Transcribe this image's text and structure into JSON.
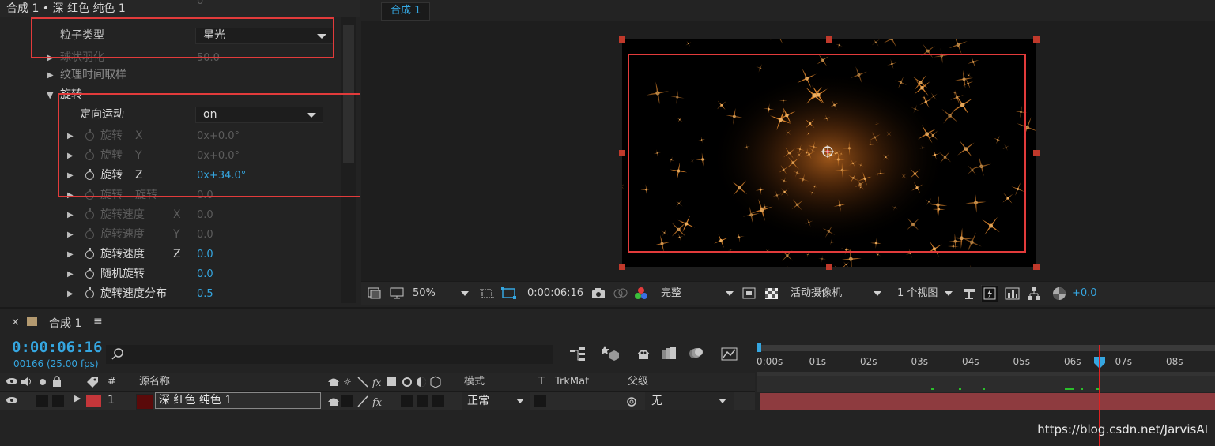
{
  "effects_panel": {
    "header": "合成 1 • 深 红色 纯色 1",
    "header_partial_value": "0",
    "rows": {
      "particle_type_label": "粒子类型",
      "particle_type_value": "星光",
      "sphere_feather_label": "球状羽化",
      "sphere_feather_value": "50.0",
      "texture_time_label": "纹理时间取样",
      "rotation_label": "旋转",
      "orient_motion_label": "定向运动",
      "orient_motion_value": "on",
      "rot_x_label": "旋转",
      "rot_x_axis": "X",
      "rot_x_value": "0x+0.0°",
      "rot_y_label": "旋转",
      "rot_y_axis": "Y",
      "rot_y_value": "0x+0.0°",
      "rot_z_label": "旋转",
      "rot_z_axis": "Z",
      "rot_z_value": "0x+34.0°",
      "rot_spin_label": "旋转",
      "rot_spin_label2": "旋转",
      "rot_spin_value": "0.0",
      "rspeed_x_label": "旋转速度",
      "rspeed_x_axis": "X",
      "rspeed_x_value": "0.0",
      "rspeed_y_label": "旋转速度",
      "rspeed_y_axis": "Y",
      "rspeed_y_value": "0.0",
      "rspeed_z_label": "旋转速度",
      "rspeed_z_axis": "Z",
      "rspeed_z_value": "0.0",
      "random_rot_label": "随机旋转",
      "random_rot_value": "0.0",
      "rspeed_dist_label": "旋转速度分布",
      "rspeed_dist_value": "0.5"
    }
  },
  "viewer": {
    "tab": "合成 1",
    "zoom": "50%",
    "timecode": "0:00:06:16",
    "resolution": "完整",
    "camera": "活动摄像机",
    "views": "1 个视图",
    "exposure": "+0.0"
  },
  "timeline": {
    "tab": "合成 1",
    "timecode": "0:00:06:16",
    "frames": "00166 (25.00 fps)",
    "columns": {
      "num": "#",
      "source_name": "源名称",
      "mode": "模式",
      "t": "T",
      "trkmat": "TrkMat",
      "parent": "父级"
    },
    "layer": {
      "index": "1",
      "name": "深 红色 纯色 1",
      "mode": "正常",
      "parent": "无"
    },
    "ruler_ticks": [
      "0:00s",
      "01s",
      "02s",
      "03s",
      "04s",
      "05s",
      "06s",
      "07s",
      "08s"
    ],
    "watermark": "https://blog.csdn.net/JarvisAI"
  },
  "colors": {
    "accent": "#35a6e0",
    "highlight_box": "#e23b3b",
    "layer_label": "#c4363a",
    "track": "#8e3b3f",
    "sparkle": "#d9822b"
  }
}
